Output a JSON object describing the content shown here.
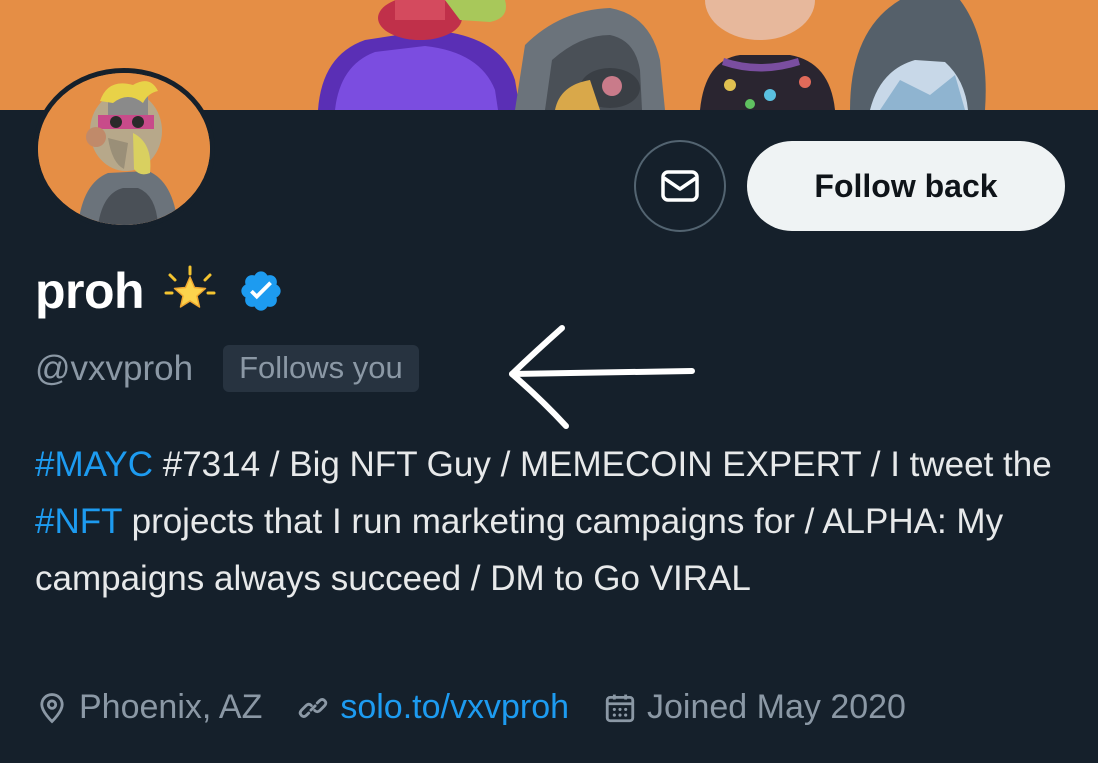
{
  "profile": {
    "display_name": "proh",
    "handle": "@vxvproh",
    "follows_you_label": "Follows you",
    "follow_button_label": "Follow back",
    "bio": {
      "part1_tag": "#MAYC",
      "part2": " #7314 / Big NFT Guy / MEMECOIN EXPERT / I tweet the ",
      "part3_tag": "#NFT",
      "part4": " projects that I run marketing campaigns for / ALPHA: My campaigns always succeed / DM to Go VIRAL"
    },
    "location": "Phoenix, AZ",
    "website": "solo.to/vxvproh",
    "joined": "Joined May 2020"
  },
  "icons": {
    "message": "envelope-icon",
    "name_emoji": "glowing-star-icon",
    "verified": "verified-badge-icon",
    "location": "location-pin-icon",
    "website": "link-icon",
    "joined": "calendar-icon"
  },
  "colors": {
    "background": "#15202b",
    "accent": "#1d9bf0",
    "muted_text": "#8b98a5",
    "banner": "#e58e45"
  }
}
